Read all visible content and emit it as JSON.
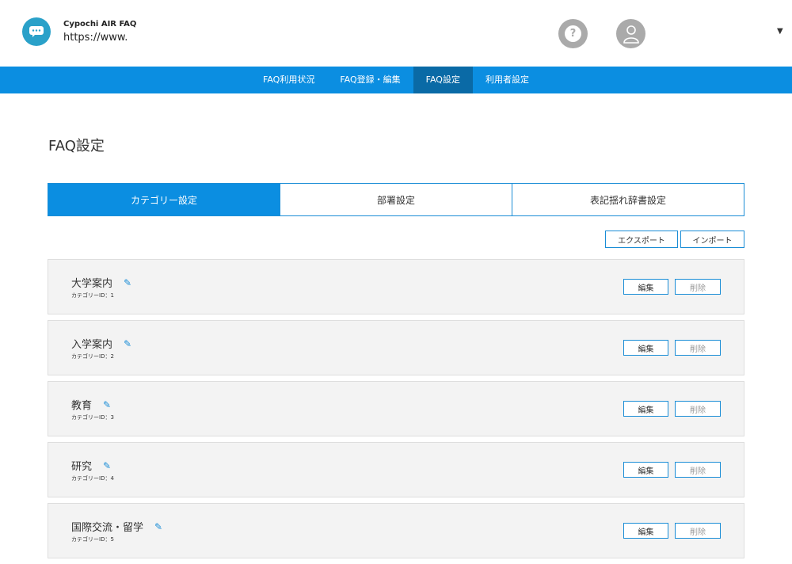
{
  "app": {
    "name": "Cypochi AIR FAQ",
    "url": "https://www."
  },
  "header": {
    "help_icon_text": "?"
  },
  "nav": {
    "items": [
      {
        "label": "FAQ利用状況"
      },
      {
        "label": "FAQ登録・編集"
      },
      {
        "label": "FAQ設定",
        "active": true
      },
      {
        "label": "利用者設定"
      }
    ]
  },
  "page": {
    "title": "FAQ設定"
  },
  "tabs": [
    {
      "label": "カテゴリー設定",
      "active": true
    },
    {
      "label": "部署設定"
    },
    {
      "label": "表記揺れ辞書設定"
    }
  ],
  "toolbar": {
    "export_label": "エクスポート",
    "import_label": "インポート"
  },
  "categories": [
    {
      "name": "大学案内",
      "id_text": "カテゴリーID：1",
      "edit_label": "編集",
      "delete_label": "削除"
    },
    {
      "name": "入学案内",
      "id_text": "カテゴリーID：2",
      "edit_label": "編集",
      "delete_label": "削除"
    },
    {
      "name": "教育",
      "id_text": "カテゴリーID：3",
      "edit_label": "編集",
      "delete_label": "削除"
    },
    {
      "name": "研究",
      "id_text": "カテゴリーID：4",
      "edit_label": "編集",
      "delete_label": "削除"
    },
    {
      "name": "国際交流・留学",
      "id_text": "カテゴリーID：5",
      "edit_label": "編集",
      "delete_label": "削除"
    }
  ],
  "colors": {
    "primary": "#0b8ee1",
    "primary_dark": "#0a6aa6",
    "logo": "#2aa1c9",
    "card_bg": "#f3f3f3"
  },
  "icons": {
    "logo": "chat-bubble-icon",
    "help": "question-icon",
    "user": "user-icon",
    "caret": "caret-down-icon",
    "edit": "pencil-icon"
  }
}
